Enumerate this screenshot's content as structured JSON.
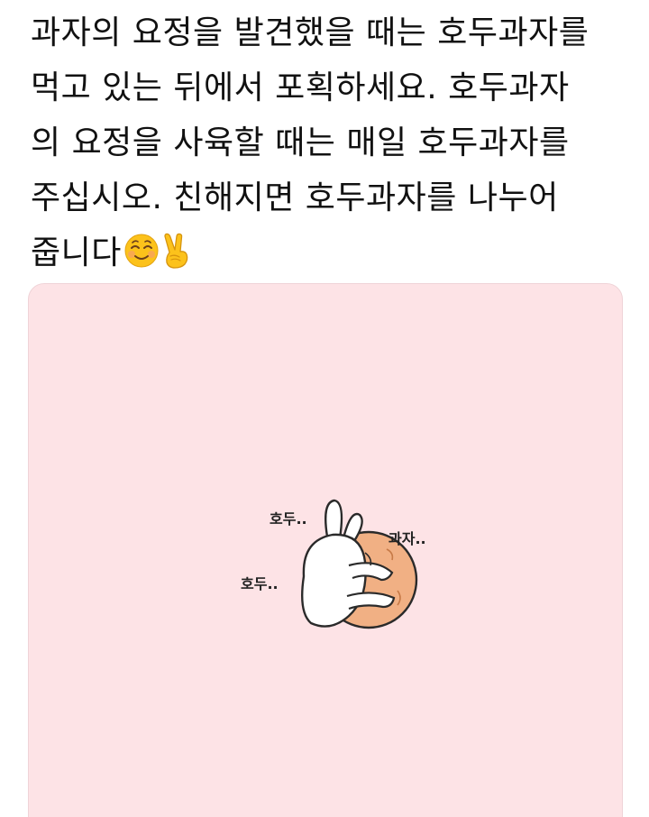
{
  "tweet": {
    "lines": [
      "과자의 요정을 발견했을 때는 호두과자를",
      "먹고 있는 뒤에서 포획하세요. 호두과자",
      "의 요정을 사육할 때는 매일 호두과자를",
      "주십시오. 친해지면 호두과자를 나누어",
      "줍니다"
    ],
    "emojis": [
      "smiling-face-icon",
      "victory-hand-icon"
    ]
  },
  "media": {
    "background_color": "#fde3e6",
    "illustration_labels": {
      "top_left": "호두..",
      "left": "호두..",
      "right": "과자.."
    },
    "cookie_color": "#f1b084"
  }
}
